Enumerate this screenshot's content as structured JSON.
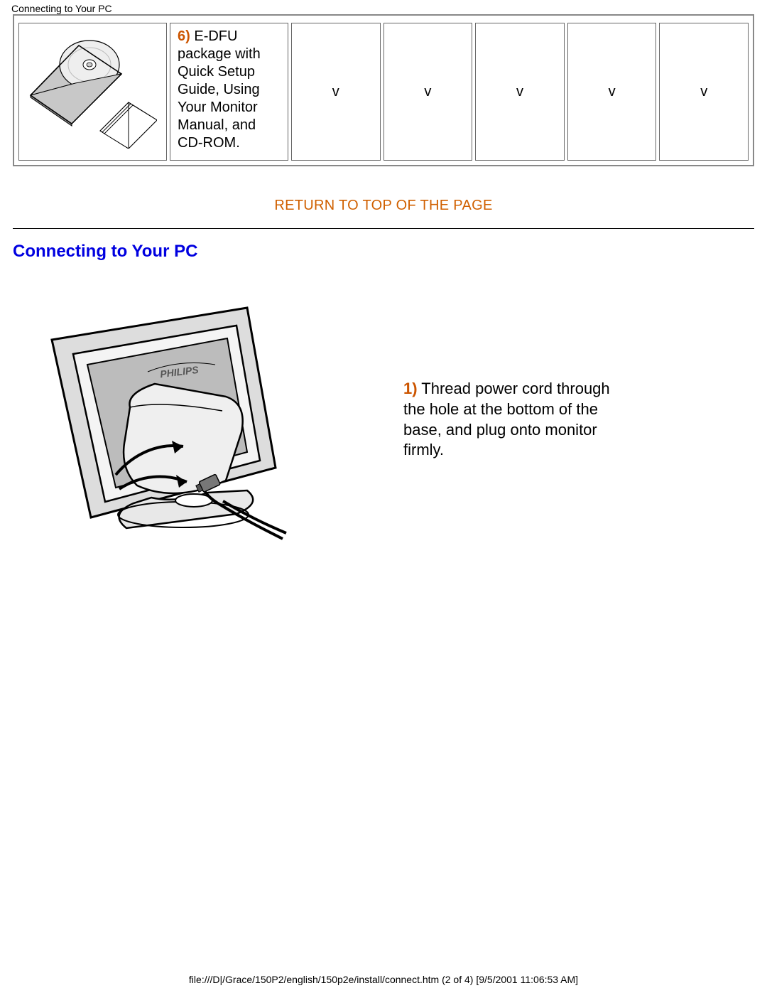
{
  "header": {
    "title": "Connecting to Your PC"
  },
  "table": {
    "item_number": "6)",
    "item_title": " E-DFU",
    "item_desc": " package with Quick Setup Guide, Using Your Monitor Manual, and CD-ROM.",
    "v_cells": [
      "v",
      "v",
      "v",
      "v",
      "v"
    ]
  },
  "return_link": "RETURN TO TOP OF THE PAGE",
  "section_heading": "Connecting to Your PC",
  "step1": {
    "number": "1)",
    "text": " Thread power cord through the hole at the bottom of the base, and plug onto monitor firmly."
  },
  "footer": "file:///D|/Grace/150P2/english/150p2e/install/connect.htm (2 of 4) [9/5/2001 11:06:53 AM]"
}
